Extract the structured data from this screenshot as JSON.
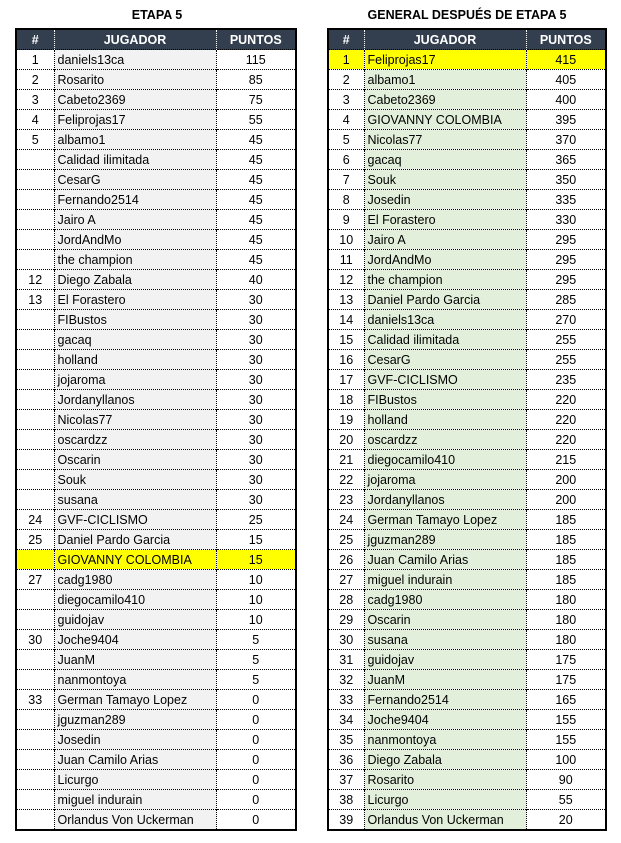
{
  "left": {
    "title": "ETAPA 5",
    "headers": [
      "#",
      "JUGADOR",
      "PUNTOS"
    ],
    "highlight_color": "#ffff00",
    "rows": [
      {
        "rank": "1",
        "name": "daniels13ca",
        "points": "115"
      },
      {
        "rank": "2",
        "name": "Rosarito",
        "points": "85"
      },
      {
        "rank": "3",
        "name": "Cabeto2369",
        "points": "75"
      },
      {
        "rank": "4",
        "name": "Feliprojas17",
        "points": "55"
      },
      {
        "rank": "5",
        "name": "albamo1",
        "points": "45"
      },
      {
        "rank": "",
        "name": "Calidad ilimitada",
        "points": "45"
      },
      {
        "rank": "",
        "name": "CesarG",
        "points": "45"
      },
      {
        "rank": "",
        "name": "Fernando2514",
        "points": "45"
      },
      {
        "rank": "",
        "name": "Jairo A",
        "points": "45"
      },
      {
        "rank": "",
        "name": "JordAndMo",
        "points": "45"
      },
      {
        "rank": "",
        "name": "the champion",
        "points": "45"
      },
      {
        "rank": "12",
        "name": "Diego Zabala",
        "points": "40"
      },
      {
        "rank": "13",
        "name": "El Forastero",
        "points": "30"
      },
      {
        "rank": "",
        "name": "FIBustos",
        "points": "30"
      },
      {
        "rank": "",
        "name": "gacaq",
        "points": "30"
      },
      {
        "rank": "",
        "name": "holland",
        "points": "30"
      },
      {
        "rank": "",
        "name": "jojaroma",
        "points": "30"
      },
      {
        "rank": "",
        "name": "Jordanyllanos",
        "points": "30"
      },
      {
        "rank": "",
        "name": "Nicolas77",
        "points": "30"
      },
      {
        "rank": "",
        "name": "oscardzz",
        "points": "30"
      },
      {
        "rank": "",
        "name": "Oscarin",
        "points": "30"
      },
      {
        "rank": "",
        "name": "Souk",
        "points": "30"
      },
      {
        "rank": "",
        "name": "susana",
        "points": "30"
      },
      {
        "rank": "24",
        "name": "GVF-CICLISMO",
        "points": "25"
      },
      {
        "rank": "25",
        "name": "Daniel Pardo Garcia",
        "points": "15"
      },
      {
        "rank": "",
        "name": "GIOVANNY COLOMBIA",
        "points": "15",
        "highlight": true
      },
      {
        "rank": "27",
        "name": "cadg1980",
        "points": "10"
      },
      {
        "rank": "",
        "name": "diegocamilo410",
        "points": "10"
      },
      {
        "rank": "",
        "name": "guidojav",
        "points": "10"
      },
      {
        "rank": "30",
        "name": "Joche9404",
        "points": "5"
      },
      {
        "rank": "",
        "name": "JuanM",
        "points": "5"
      },
      {
        "rank": "",
        "name": "nanmontoya",
        "points": "5"
      },
      {
        "rank": "33",
        "name": "German Tamayo Lopez",
        "points": "0"
      },
      {
        "rank": "",
        "name": "jguzman289",
        "points": "0"
      },
      {
        "rank": "",
        "name": "Josedin",
        "points": "0"
      },
      {
        "rank": "",
        "name": "Juan Camilo Arias",
        "points": "0"
      },
      {
        "rank": "",
        "name": "Licurgo",
        "points": "0"
      },
      {
        "rank": "",
        "name": "miguel indurain",
        "points": "0"
      },
      {
        "rank": "",
        "name": "Orlandus Von Uckerman",
        "points": "0"
      }
    ]
  },
  "right": {
    "title": "GENERAL DESPUÉS DE ETAPA 5",
    "headers": [
      "#",
      "JUGADOR",
      "PUNTOS"
    ],
    "rows": [
      {
        "rank": "1",
        "name": "Feliprojas17",
        "points": "415",
        "highlight": true
      },
      {
        "rank": "2",
        "name": "albamo1",
        "points": "405"
      },
      {
        "rank": "3",
        "name": "Cabeto2369",
        "points": "400"
      },
      {
        "rank": "4",
        "name": "GIOVANNY COLOMBIA",
        "points": "395"
      },
      {
        "rank": "5",
        "name": "Nicolas77",
        "points": "370"
      },
      {
        "rank": "6",
        "name": "gacaq",
        "points": "365"
      },
      {
        "rank": "7",
        "name": "Souk",
        "points": "350"
      },
      {
        "rank": "8",
        "name": "Josedin",
        "points": "335"
      },
      {
        "rank": "9",
        "name": "El Forastero",
        "points": "330"
      },
      {
        "rank": "10",
        "name": "Jairo A",
        "points": "295"
      },
      {
        "rank": "11",
        "name": "JordAndMo",
        "points": "295"
      },
      {
        "rank": "12",
        "name": "the champion",
        "points": "295"
      },
      {
        "rank": "13",
        "name": "Daniel Pardo Garcia",
        "points": "285"
      },
      {
        "rank": "14",
        "name": "daniels13ca",
        "points": "270"
      },
      {
        "rank": "15",
        "name": "Calidad ilimitada",
        "points": "255"
      },
      {
        "rank": "16",
        "name": "CesarG",
        "points": "255"
      },
      {
        "rank": "17",
        "name": "GVF-CICLISMO",
        "points": "235"
      },
      {
        "rank": "18",
        "name": "FIBustos",
        "points": "220"
      },
      {
        "rank": "19",
        "name": "holland",
        "points": "220"
      },
      {
        "rank": "20",
        "name": "oscardzz",
        "points": "220"
      },
      {
        "rank": "21",
        "name": "diegocamilo410",
        "points": "215"
      },
      {
        "rank": "22",
        "name": "jojaroma",
        "points": "200"
      },
      {
        "rank": "23",
        "name": "Jordanyllanos",
        "points": "200"
      },
      {
        "rank": "24",
        "name": "German Tamayo Lopez",
        "points": "185"
      },
      {
        "rank": "25",
        "name": "jguzman289",
        "points": "185"
      },
      {
        "rank": "26",
        "name": "Juan Camilo Arias",
        "points": "185"
      },
      {
        "rank": "27",
        "name": "miguel indurain",
        "points": "185"
      },
      {
        "rank": "28",
        "name": "cadg1980",
        "points": "180"
      },
      {
        "rank": "29",
        "name": "Oscarin",
        "points": "180"
      },
      {
        "rank": "30",
        "name": "susana",
        "points": "180"
      },
      {
        "rank": "31",
        "name": "guidojav",
        "points": "175"
      },
      {
        "rank": "32",
        "name": "JuanM",
        "points": "175"
      },
      {
        "rank": "33",
        "name": "Fernando2514",
        "points": "165"
      },
      {
        "rank": "34",
        "name": "Joche9404",
        "points": "155"
      },
      {
        "rank": "35",
        "name": "nanmontoya",
        "points": "155"
      },
      {
        "rank": "36",
        "name": "Diego Zabala",
        "points": "100"
      },
      {
        "rank": "37",
        "name": "Rosarito",
        "points": "90"
      },
      {
        "rank": "38",
        "name": "Licurgo",
        "points": "55"
      },
      {
        "rank": "39",
        "name": "Orlandus Von Uckerman",
        "points": "20"
      }
    ]
  }
}
